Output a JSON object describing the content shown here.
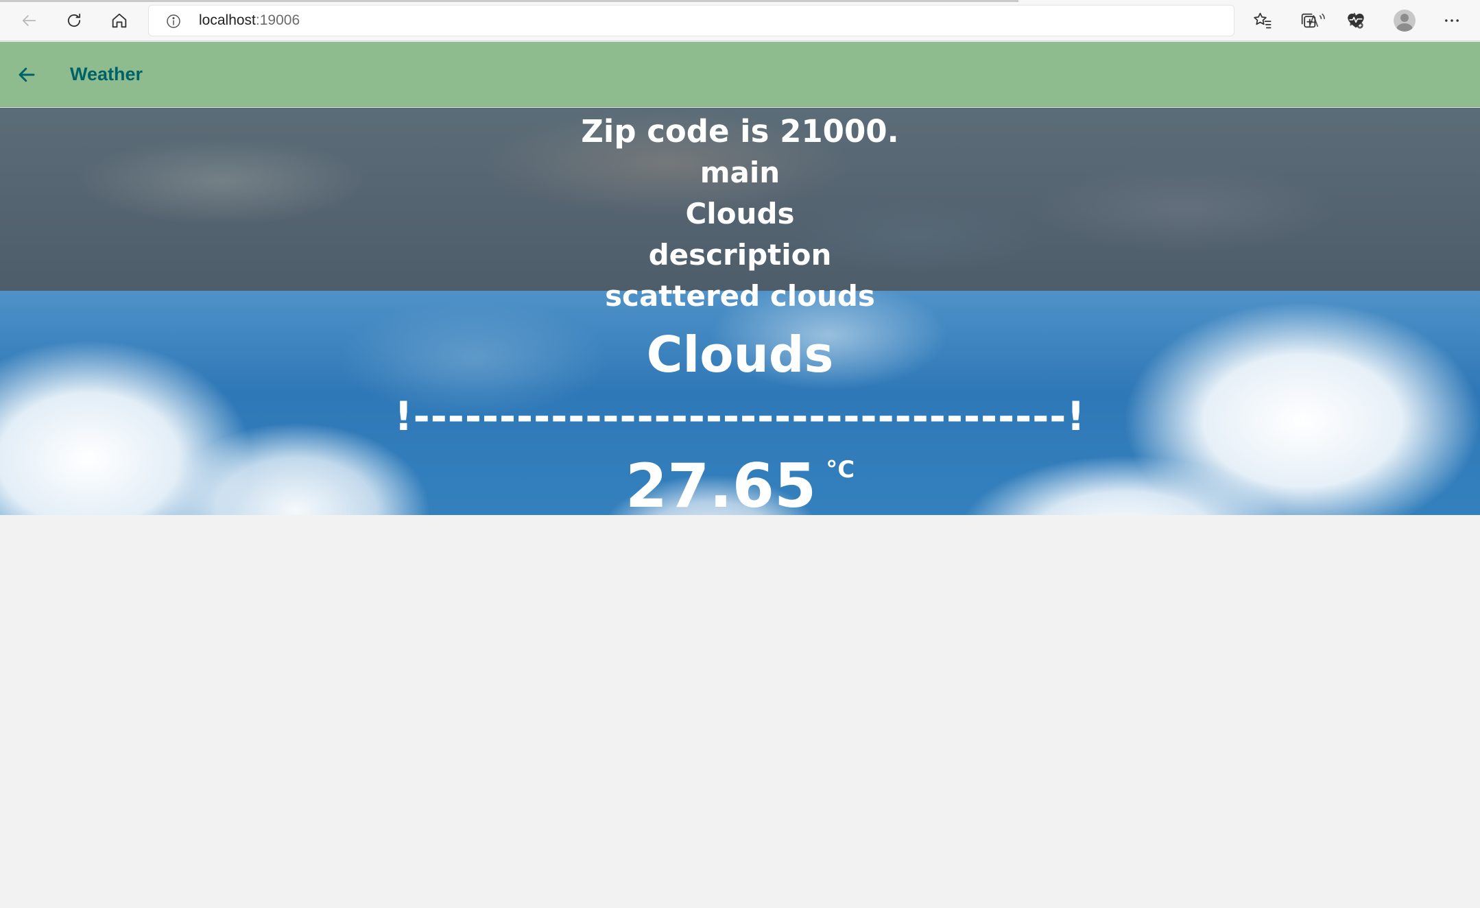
{
  "browser": {
    "url_host": "localhost",
    "url_port": ":19006",
    "icons": {
      "back": "back-arrow-icon",
      "refresh": "refresh-icon",
      "home": "home-icon",
      "info": "info-icon",
      "read_aloud": "read-aloud-icon",
      "favorite_add": "add-favorite-icon",
      "favorites": "favorites-icon",
      "collections": "collections-icon",
      "health": "browser-essentials-icon",
      "profile": "profile-avatar",
      "more": "more-icon"
    }
  },
  "app": {
    "title": "Weather",
    "header_color": "#8fbc8f",
    "title_color": "#006266"
  },
  "weather": {
    "zip_line": "Zip code is 21000.",
    "main_label": "main",
    "main_value": "Clouds",
    "description_label": "description",
    "description_value": "scattered clouds",
    "headline": "Clouds",
    "divider": "!--------------------------------------!",
    "temperature": "27.65",
    "unit": "°C"
  }
}
